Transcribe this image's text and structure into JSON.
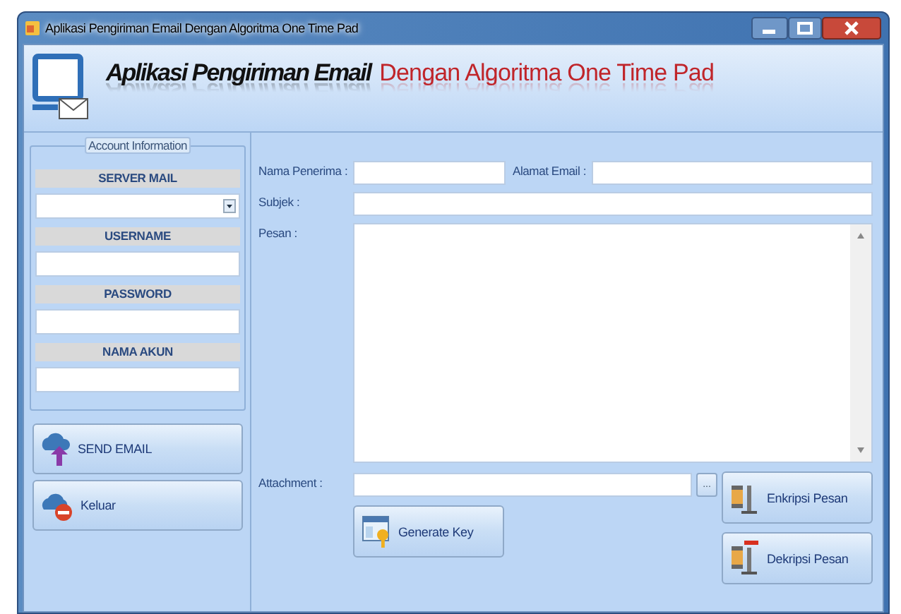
{
  "window": {
    "title": "Aplikasi Pengiriman Email Dengan Algoritma One Time Pad"
  },
  "header": {
    "title_dark": "Aplikasi Pengiriman Email",
    "title_red": "Dengan Algoritma One Time Pad"
  },
  "account": {
    "title": "Account Information",
    "fields": [
      {
        "label": "SERVER MAIL",
        "kind": "dropdown"
      },
      {
        "label": "USERNAME",
        "kind": "text"
      },
      {
        "label": "PASSWORD",
        "kind": "text"
      },
      {
        "label": "NAMA AKUN",
        "kind": "text"
      }
    ]
  },
  "actions": [
    {
      "label": "SEND EMAIL",
      "kind": "send"
    },
    {
      "label": "Keluar",
      "kind": "exit"
    }
  ],
  "form": {
    "recipient_label": "Nama Penerima :",
    "email_label": "Alamat Email :",
    "subject_label": "Subjek :",
    "message_label": "Pesan :",
    "attachment_label": "Attachment :",
    "browse_button": "..."
  },
  "buttons": [
    {
      "label": "Generate Key",
      "kind": "generate"
    },
    {
      "label": "Enkripsi Pesan",
      "kind": "encrypt"
    },
    {
      "label": "Dekripsi Pesan",
      "kind": "decrypt"
    }
  ]
}
